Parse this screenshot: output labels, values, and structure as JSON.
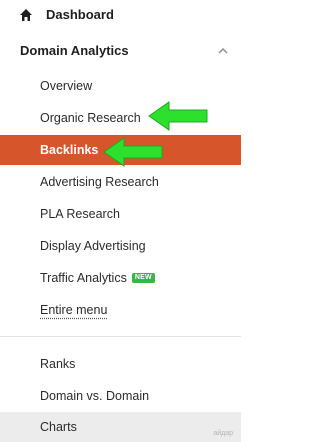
{
  "nav": {
    "dashboard_label": "Dashboard",
    "section_title": "Domain Analytics",
    "items": [
      {
        "label": "Overview"
      },
      {
        "label": "Organic Research"
      },
      {
        "label": "Backlinks",
        "active": true
      },
      {
        "label": "Advertising Research"
      },
      {
        "label": "PLA Research"
      },
      {
        "label": "Display Advertising"
      },
      {
        "label": "Traffic Analytics",
        "badge": "NEW"
      },
      {
        "label": "Entire menu"
      }
    ],
    "secondary_items": [
      {
        "label": "Ranks"
      },
      {
        "label": "Domain vs. Domain"
      },
      {
        "label": "Charts"
      }
    ]
  },
  "annotations": {
    "arrow_color": "#2ee02e"
  },
  "colors": {
    "active_bg": "#d6552b",
    "badge_bg": "#39b54a"
  },
  "watermark": "айдар"
}
